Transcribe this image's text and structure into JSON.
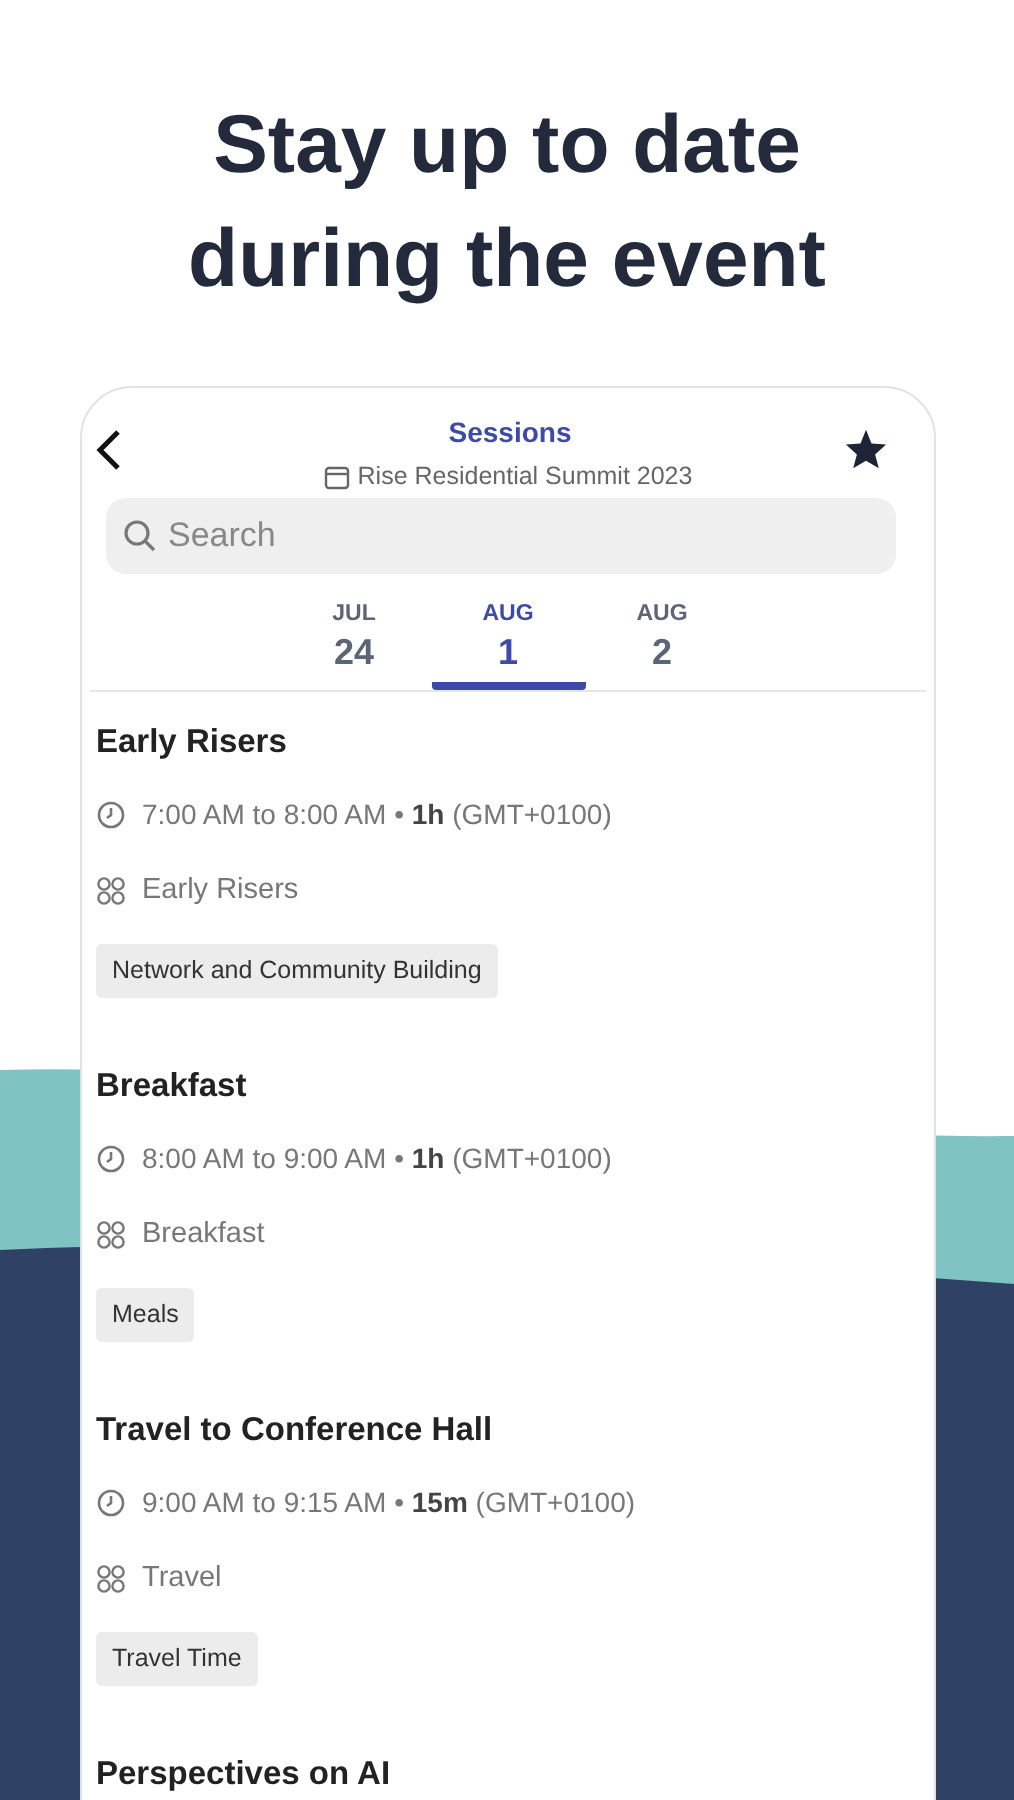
{
  "headline": "Stay up to date during the event",
  "header": {
    "title": "Sessions",
    "subtitle": "Rise Residential Summit 2023"
  },
  "search": {
    "placeholder": "Search"
  },
  "dates": [
    {
      "month": "JUL",
      "day": "24",
      "selected": false
    },
    {
      "month": "AUG",
      "day": "1",
      "selected": true
    },
    {
      "month": "AUG",
      "day": "2",
      "selected": false
    }
  ],
  "sessions": [
    {
      "title": "Early Risers",
      "time": "7:00 AM to 8:00 AM • **1h** (GMT+0100)",
      "track": "Early Risers",
      "tag": "Network and Community Building"
    },
    {
      "title": "Breakfast",
      "time": "8:00 AM to 9:00 AM • **1h** (GMT+0100)",
      "track": "Breakfast",
      "tag": "Meals"
    },
    {
      "title": "Travel to Conference Hall",
      "time": "9:00 AM to 9:15 AM • **15m** (GMT+0100)",
      "track": "Travel",
      "tag": "Travel Time"
    },
    {
      "title": "Perspectives on AI"
    }
  ]
}
